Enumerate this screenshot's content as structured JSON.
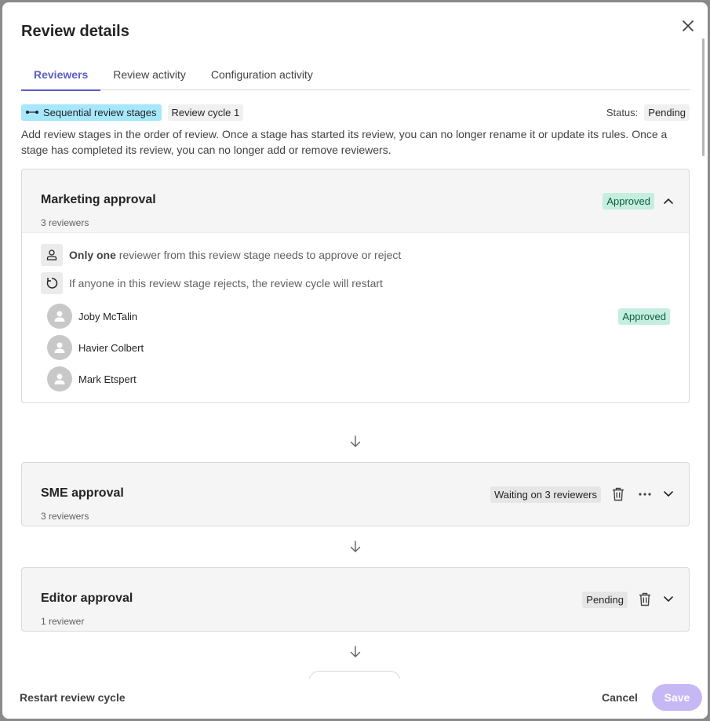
{
  "dialog": {
    "title": "Review details"
  },
  "tabs": [
    {
      "label": "Reviewers",
      "active": true
    },
    {
      "label": "Review activity",
      "active": false
    },
    {
      "label": "Configuration activity",
      "active": false
    }
  ],
  "meta": {
    "sequential_label": "Sequential review stages",
    "cycle_label": "Review cycle 1",
    "status_label": "Status:",
    "status_value": "Pending"
  },
  "description": "Add review stages in the order of review. Once a stage has started its review, you can no longer rename it or update its rules. Once a stage has completed its review, you can no longer add or remove reviewers.",
  "stages": [
    {
      "title": "Marketing approval",
      "subtitle": "3 reviewers",
      "badge": "Approved",
      "rules": [
        {
          "bold": "Only one",
          "text": " reviewer from this review stage needs to approve or reject",
          "icon": "person-icon"
        },
        {
          "bold": "",
          "text": "If anyone in this review stage rejects, the review cycle will restart",
          "icon": "restart-icon"
        }
      ],
      "reviewers": [
        {
          "name": "Joby McTalin",
          "badge": "Approved"
        },
        {
          "name": "Havier Colbert",
          "badge": ""
        },
        {
          "name": "Mark Etspert",
          "badge": ""
        }
      ]
    },
    {
      "title": "SME approval",
      "subtitle": "3 reviewers",
      "badge": "Waiting on 3 reviewers"
    },
    {
      "title": "Editor approval",
      "subtitle": "1 reviewer",
      "badge": "Pending"
    }
  ],
  "footer": {
    "restart_label": "Restart review cycle",
    "cancel_label": "Cancel",
    "save_label": "Save"
  },
  "colors": {
    "accent": "#5b5fc7",
    "approved_bg": "#c4eedf",
    "sequential_bg": "#a6e7fb",
    "save_disabled": "#c5b8f5"
  }
}
